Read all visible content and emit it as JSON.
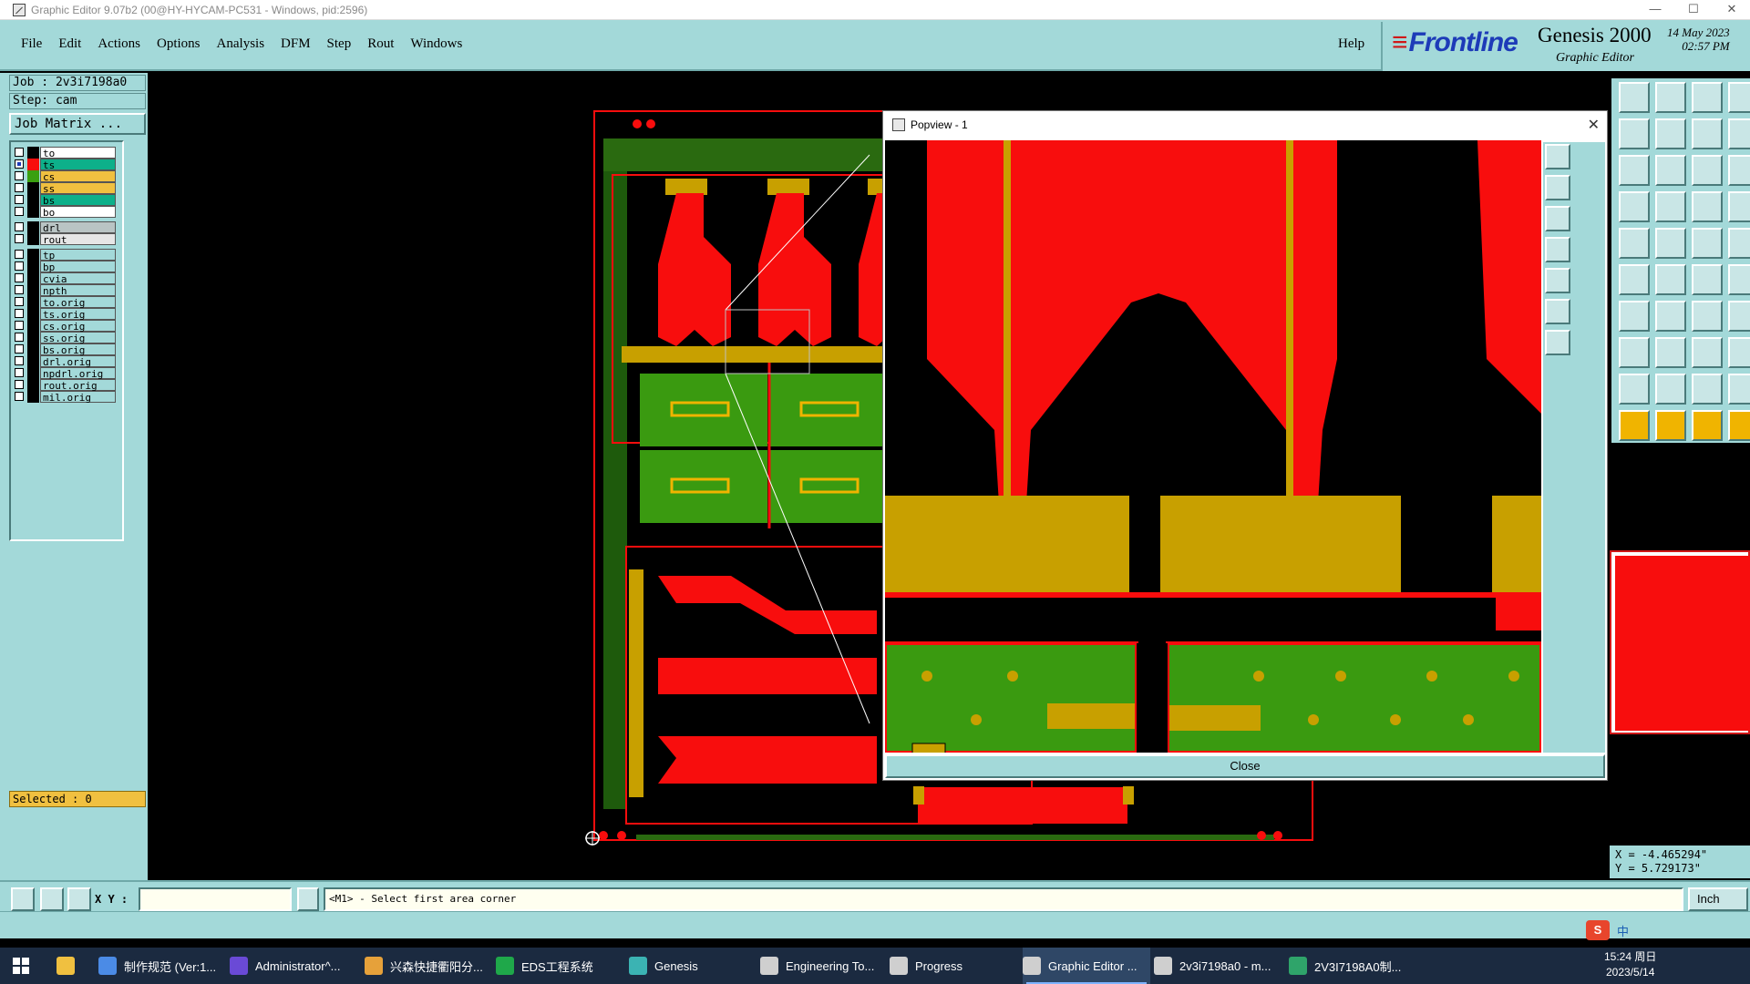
{
  "window": {
    "title": "Graphic Editor 9.07b2 (00@HY-HYCAM-PC531 - Windows, pid:2596)",
    "controls": [
      "—",
      "☐",
      "✕"
    ]
  },
  "menubar": {
    "menus": [
      "File",
      "Edit",
      "Actions",
      "Options",
      "Analysis",
      "DFM",
      "Step",
      "Rout",
      "Windows"
    ],
    "help": "Help"
  },
  "brand": {
    "logo": "Frontline",
    "product": "Genesis 2000",
    "subtitle": "Graphic Editor",
    "date": "14 May 2023\n02:57 PM"
  },
  "job": {
    "job_label": "Job : 2v3i7198a0",
    "step_label": "Step: cam",
    "matrix_button": "Job Matrix ..."
  },
  "layers": [
    {
      "name": "to",
      "color": "#ffffff",
      "swatch": "#000000",
      "checked": false
    },
    {
      "name": "ts",
      "color": "#0db08a",
      "swatch": "#f80d0d",
      "checked": true
    },
    {
      "name": "cs",
      "color": "#f0c040",
      "swatch": "#3aa010",
      "checked": false
    },
    {
      "name": "ss",
      "color": "#f0c040",
      "swatch": "#000000",
      "checked": false
    },
    {
      "name": "bs",
      "color": "#0db08a",
      "swatch": "#000000",
      "checked": false
    },
    {
      "name": "bo",
      "color": "#ffffff",
      "swatch": "#000000",
      "checked": false
    },
    {
      "name": "drl",
      "color": "#b9c4c4",
      "swatch": "#000000",
      "checked": false
    },
    {
      "name": "rout",
      "color": "#e6e6e6",
      "swatch": "#000000",
      "checked": false
    },
    {
      "name": "tp",
      "color": "#a3d9d9",
      "swatch": "#000000",
      "checked": false
    },
    {
      "name": "bp",
      "color": "#a3d9d9",
      "swatch": "#000000",
      "checked": false
    },
    {
      "name": "cvia",
      "color": "#a3d9d9",
      "swatch": "#000000",
      "checked": false
    },
    {
      "name": "npth",
      "color": "#a3d9d9",
      "swatch": "#000000",
      "checked": false
    },
    {
      "name": "to.orig",
      "color": "#a3d9d9",
      "swatch": "#000000",
      "checked": false
    },
    {
      "name": "ts.orig",
      "color": "#a3d9d9",
      "swatch": "#000000",
      "checked": false
    },
    {
      "name": "cs.orig",
      "color": "#a3d9d9",
      "swatch": "#000000",
      "checked": false
    },
    {
      "name": "ss.orig",
      "color": "#a3d9d9",
      "swatch": "#000000",
      "checked": false
    },
    {
      "name": "bs.orig",
      "color": "#a3d9d9",
      "swatch": "#000000",
      "checked": false
    },
    {
      "name": "drl.orig",
      "color": "#a3d9d9",
      "swatch": "#000000",
      "checked": false
    },
    {
      "name": "npdrl.orig",
      "color": "#a3d9d9",
      "swatch": "#000000",
      "checked": false
    },
    {
      "name": "rout.orig",
      "color": "#a3d9d9",
      "swatch": "#000000",
      "checked": false
    },
    {
      "name": "mil.orig",
      "color": "#a3d9d9",
      "swatch": "#000000",
      "checked": false
    }
  ],
  "selected_label": "Selected : 0",
  "command": {
    "xy_label": "X Y :",
    "xy_value": "",
    "prompt": "<M1> - Select first area corner",
    "unit": "Inch"
  },
  "coords": {
    "x": "X = -4.465294\"",
    "y": "Y = 5.729173\""
  },
  "popview": {
    "title": "Popview - 1",
    "close_label": "Close"
  },
  "ime": {
    "logo": "S",
    "lang": "中"
  },
  "taskbar": {
    "items": [
      {
        "label": "制作规范 (Ver:1...",
        "icon": "#4b8be6"
      },
      {
        "label": "Administrator^...",
        "icon": "#6a4ad6"
      },
      {
        "label": "兴森快捷衢阳分...",
        "icon": "#e6a13a"
      },
      {
        "label": "EDS工程系统",
        "icon": "#1fa84a"
      },
      {
        "label": "Genesis",
        "icon": "#3bb3b3"
      },
      {
        "label": "Engineering To...",
        "icon": "#cfcfcf"
      },
      {
        "label": "Progress",
        "icon": "#cfcfcf"
      },
      {
        "label": "Graphic Editor ...",
        "icon": "#cfcfcf",
        "active": true
      },
      {
        "label": "2v3i7198a0 - m...",
        "icon": "#cfcfcf"
      },
      {
        "label": "2V3I7198A0制...",
        "icon": "#2fa46a"
      }
    ],
    "time": "15:24 周日",
    "date": "2023/5/14"
  }
}
